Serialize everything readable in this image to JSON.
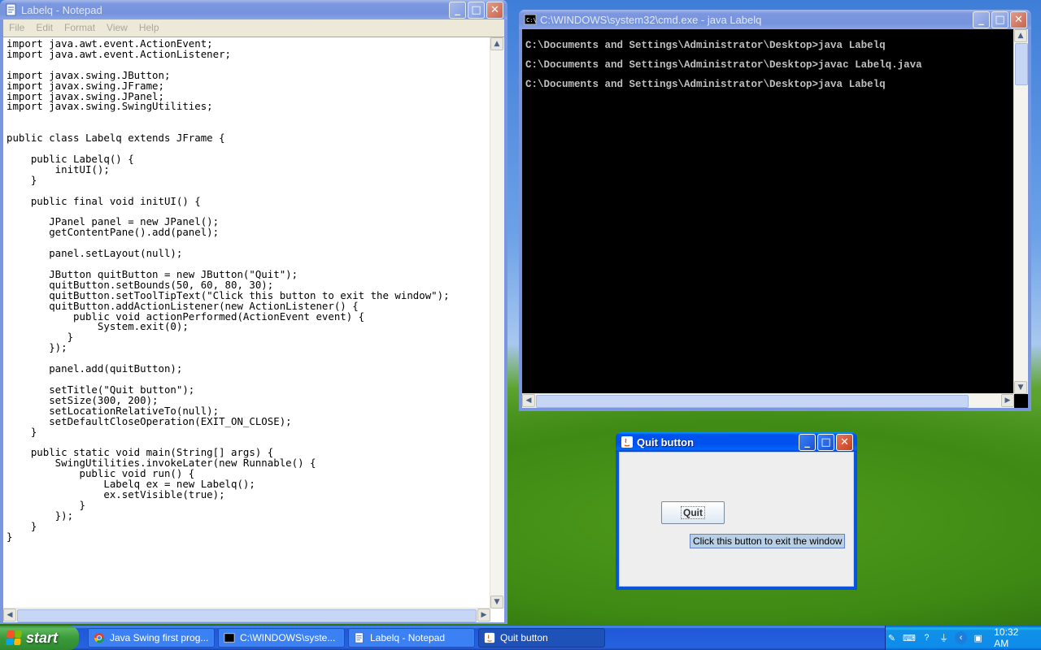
{
  "notepad": {
    "title": "Labelq - Notepad",
    "menu": [
      "File",
      "Edit",
      "Format",
      "View",
      "Help"
    ],
    "code": "import java.awt.event.ActionEvent;\nimport java.awt.event.ActionListener;\n\nimport javax.swing.JButton;\nimport javax.swing.JFrame;\nimport javax.swing.JPanel;\nimport javax.swing.SwingUtilities;\n\n\npublic class Labelq extends JFrame {\n\n    public Labelq() {\n        initUI();\n    }\n\n    public final void initUI() {\n\n       JPanel panel = new JPanel();\n       getContentPane().add(panel);\n\n       panel.setLayout(null);\n\n       JButton quitButton = new JButton(\"Quit\");\n       quitButton.setBounds(50, 60, 80, 30);\n       quitButton.setToolTipText(\"Click this button to exit the window\");\n       quitButton.addActionListener(new ActionListener() {\n           public void actionPerformed(ActionEvent event) {\n               System.exit(0);\n          }\n       });\n\n       panel.add(quitButton);\n\n       setTitle(\"Quit button\");\n       setSize(300, 200);\n       setLocationRelativeTo(null);\n       setDefaultCloseOperation(EXIT_ON_CLOSE);\n    }\n\n    public static void main(String[] args) {\n        SwingUtilities.invokeLater(new Runnable() {\n            public void run() {\n                Labelq ex = new Labelq();\n                ex.setVisible(true);\n            }\n        });\n    }\n}"
  },
  "cmd": {
    "title": "C:\\WINDOWS\\system32\\cmd.exe - java Labelq",
    "output": "C:\\Documents and Settings\\Administrator\\Desktop>java Labelq\nC:\\Documents and Settings\\Administrator\\Desktop>javac Labelq.java\nC:\\Documents and Settings\\Administrator\\Desktop>java Labelq"
  },
  "swing": {
    "title": "Quit button",
    "button_label": "Quit",
    "tooltip": "Click this button to exit the window"
  },
  "taskbar": {
    "start_label": "start",
    "tasks": [
      {
        "label": "Java Swing first prog...",
        "icon": "chrome-icon"
      },
      {
        "label": "C:\\WINDOWS\\syste...",
        "icon": "cmd-icon"
      },
      {
        "label": "Labelq - Notepad",
        "icon": "notepad-icon"
      },
      {
        "label": "Quit button",
        "icon": "java-icon"
      }
    ],
    "clock": "10:32 AM"
  }
}
